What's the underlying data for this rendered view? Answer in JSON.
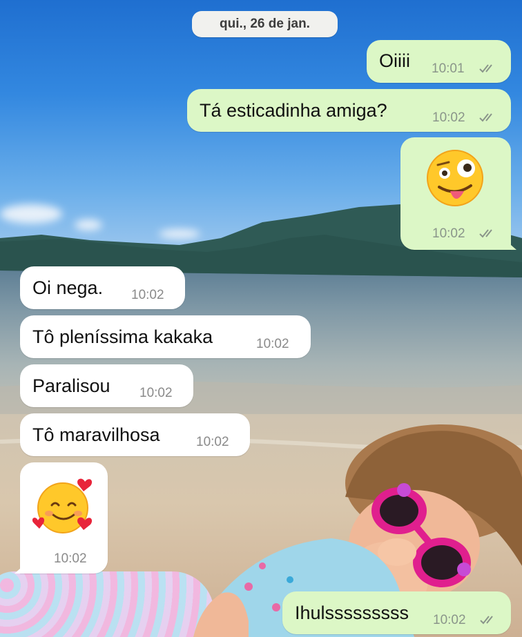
{
  "chat": {
    "date": "qui., 26 de jan.",
    "messages": [
      {
        "dir": "out",
        "text": "Oiiii",
        "time": "10:01"
      },
      {
        "dir": "out",
        "text": "Tá esticadinha amiga?",
        "time": "10:02"
      },
      {
        "dir": "out",
        "emoji": "zany-face",
        "time": "10:02"
      },
      {
        "dir": "in",
        "text": "Oi nega.",
        "time": "10:02"
      },
      {
        "dir": "in",
        "text": "Tô pleníssima kakaka",
        "time": "10:02"
      },
      {
        "dir": "in",
        "text": "Paralisou",
        "time": "10:02"
      },
      {
        "dir": "in",
        "text": "Tô maravilhosa",
        "time": "10:02"
      },
      {
        "dir": "in",
        "emoji": "smiling-face-with-hearts",
        "time": "10:02"
      },
      {
        "dir": "out",
        "text": "Ihulsssssssss",
        "time": "10:02"
      }
    ]
  },
  "colors": {
    "outgoing_bubble": "#dcf7c6",
    "incoming_bubble": "#ffffff",
    "date_chip": "#f1f1ee",
    "read_tick": "#8a958a"
  },
  "icons": {
    "read_receipt": "double-check-icon"
  }
}
